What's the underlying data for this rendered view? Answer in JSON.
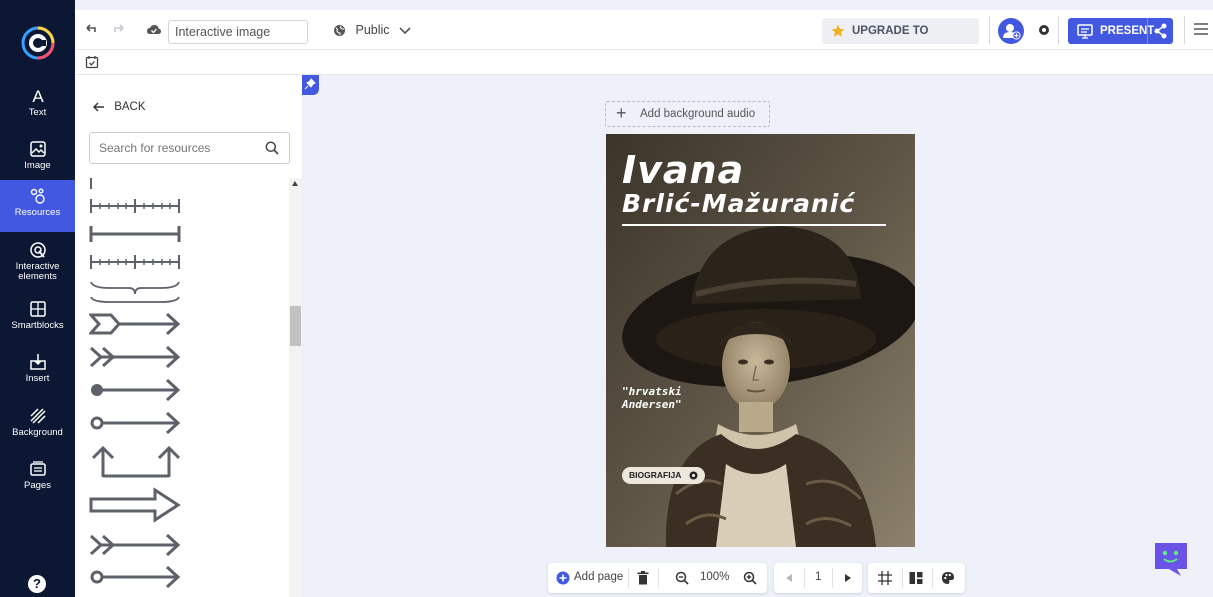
{
  "toolbar": {
    "title_value": "Interactive image",
    "title_placeholder": "Interactive image",
    "visibility": "Public",
    "upgrade_label": "UPGRADE TO PREMIUM",
    "present_label": "PRESENT"
  },
  "sidebar": {
    "items": [
      {
        "label": "Text",
        "icon": "text-icon"
      },
      {
        "label": "Image",
        "icon": "image-icon"
      },
      {
        "label": "Resources",
        "icon": "resources-icon",
        "active": true
      },
      {
        "label": "Interactive elements",
        "icon": "interactive-icon"
      },
      {
        "label": "Smartblocks",
        "icon": "smartblocks-icon"
      },
      {
        "label": "Insert",
        "icon": "insert-icon"
      },
      {
        "label": "Background",
        "icon": "background-icon"
      },
      {
        "label": "Pages",
        "icon": "pages-icon"
      }
    ],
    "help_label": "?"
  },
  "resources": {
    "back_label": "BACK",
    "search_placeholder": "Search for resources",
    "items": [
      "ruler-line",
      "ticked-ruler",
      "bracket-line",
      "ticked-ruler",
      "brace",
      "arrow-chevron-tail",
      "arrow-double-chevron",
      "arrow-dot-tail",
      "arrow-ring-tail",
      "u-turn-arrows",
      "outline-arrow",
      "arrow-double-chevron",
      "arrow-ring-tail"
    ]
  },
  "canvas": {
    "add_audio_label": "Add background audio",
    "poster": {
      "title_line1": "Ivana",
      "title_line2": "Brlić-Mažuranić",
      "quote_line1": "\"hrvatski",
      "quote_line2": "Andersen\"",
      "button_label": "BIOGRAFIJA"
    }
  },
  "bottom_bar": {
    "add_page_label": "Add page",
    "zoom": "100%",
    "page_number": "1"
  },
  "colors": {
    "accent": "#4258e0",
    "rail": "#0c1733",
    "canvas_bg": "#eef1f9",
    "upgrade_star": "#f2b01e"
  }
}
